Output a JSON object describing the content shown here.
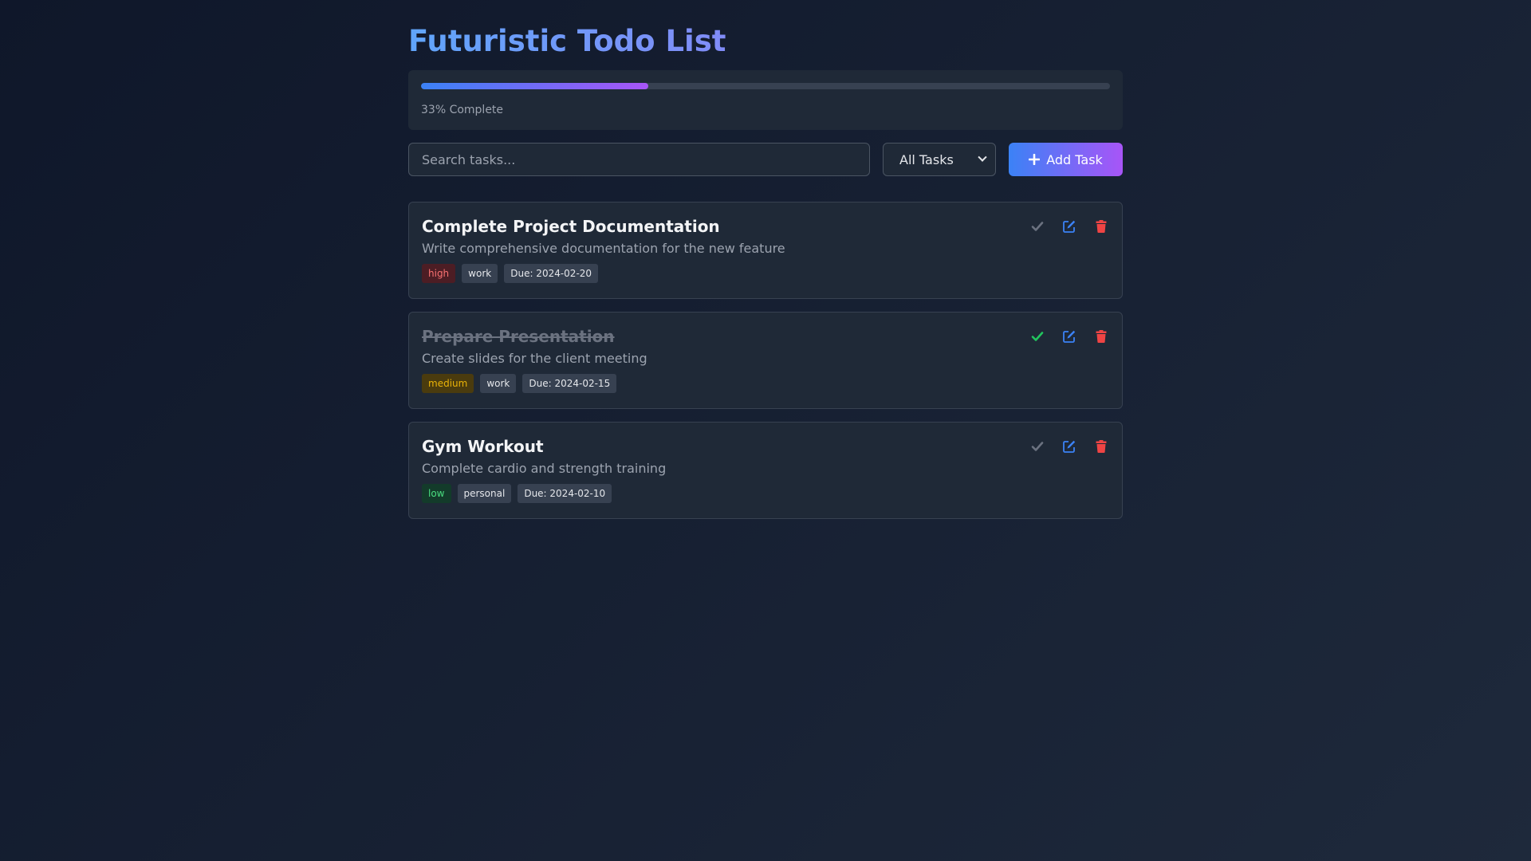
{
  "app": {
    "title": "Futuristic Todo List"
  },
  "progress": {
    "percent": 33,
    "label": "33% Complete"
  },
  "controls": {
    "search_placeholder": "Search tasks...",
    "filter_selected": "All Tasks",
    "add_label": "Add Task"
  },
  "colors": {
    "accent_start": "#3b82f6",
    "accent_end": "#a855f7",
    "complete_check": "#22c55e",
    "edit": "#3b82f6",
    "delete": "#ef4444",
    "check_inactive": "#6b7280"
  },
  "tasks": [
    {
      "title": "Complete Project Documentation",
      "description": "Write comprehensive documentation for the new feature",
      "priority": "high",
      "category": "work",
      "due": "Due: 2024-02-20",
      "completed": false
    },
    {
      "title": "Prepare Presentation",
      "description": "Create slides for the client meeting",
      "priority": "medium",
      "category": "work",
      "due": "Due: 2024-02-15",
      "completed": true
    },
    {
      "title": "Gym Workout",
      "description": "Complete cardio and strength training",
      "priority": "low",
      "category": "personal",
      "due": "Due: 2024-02-10",
      "completed": false
    }
  ]
}
